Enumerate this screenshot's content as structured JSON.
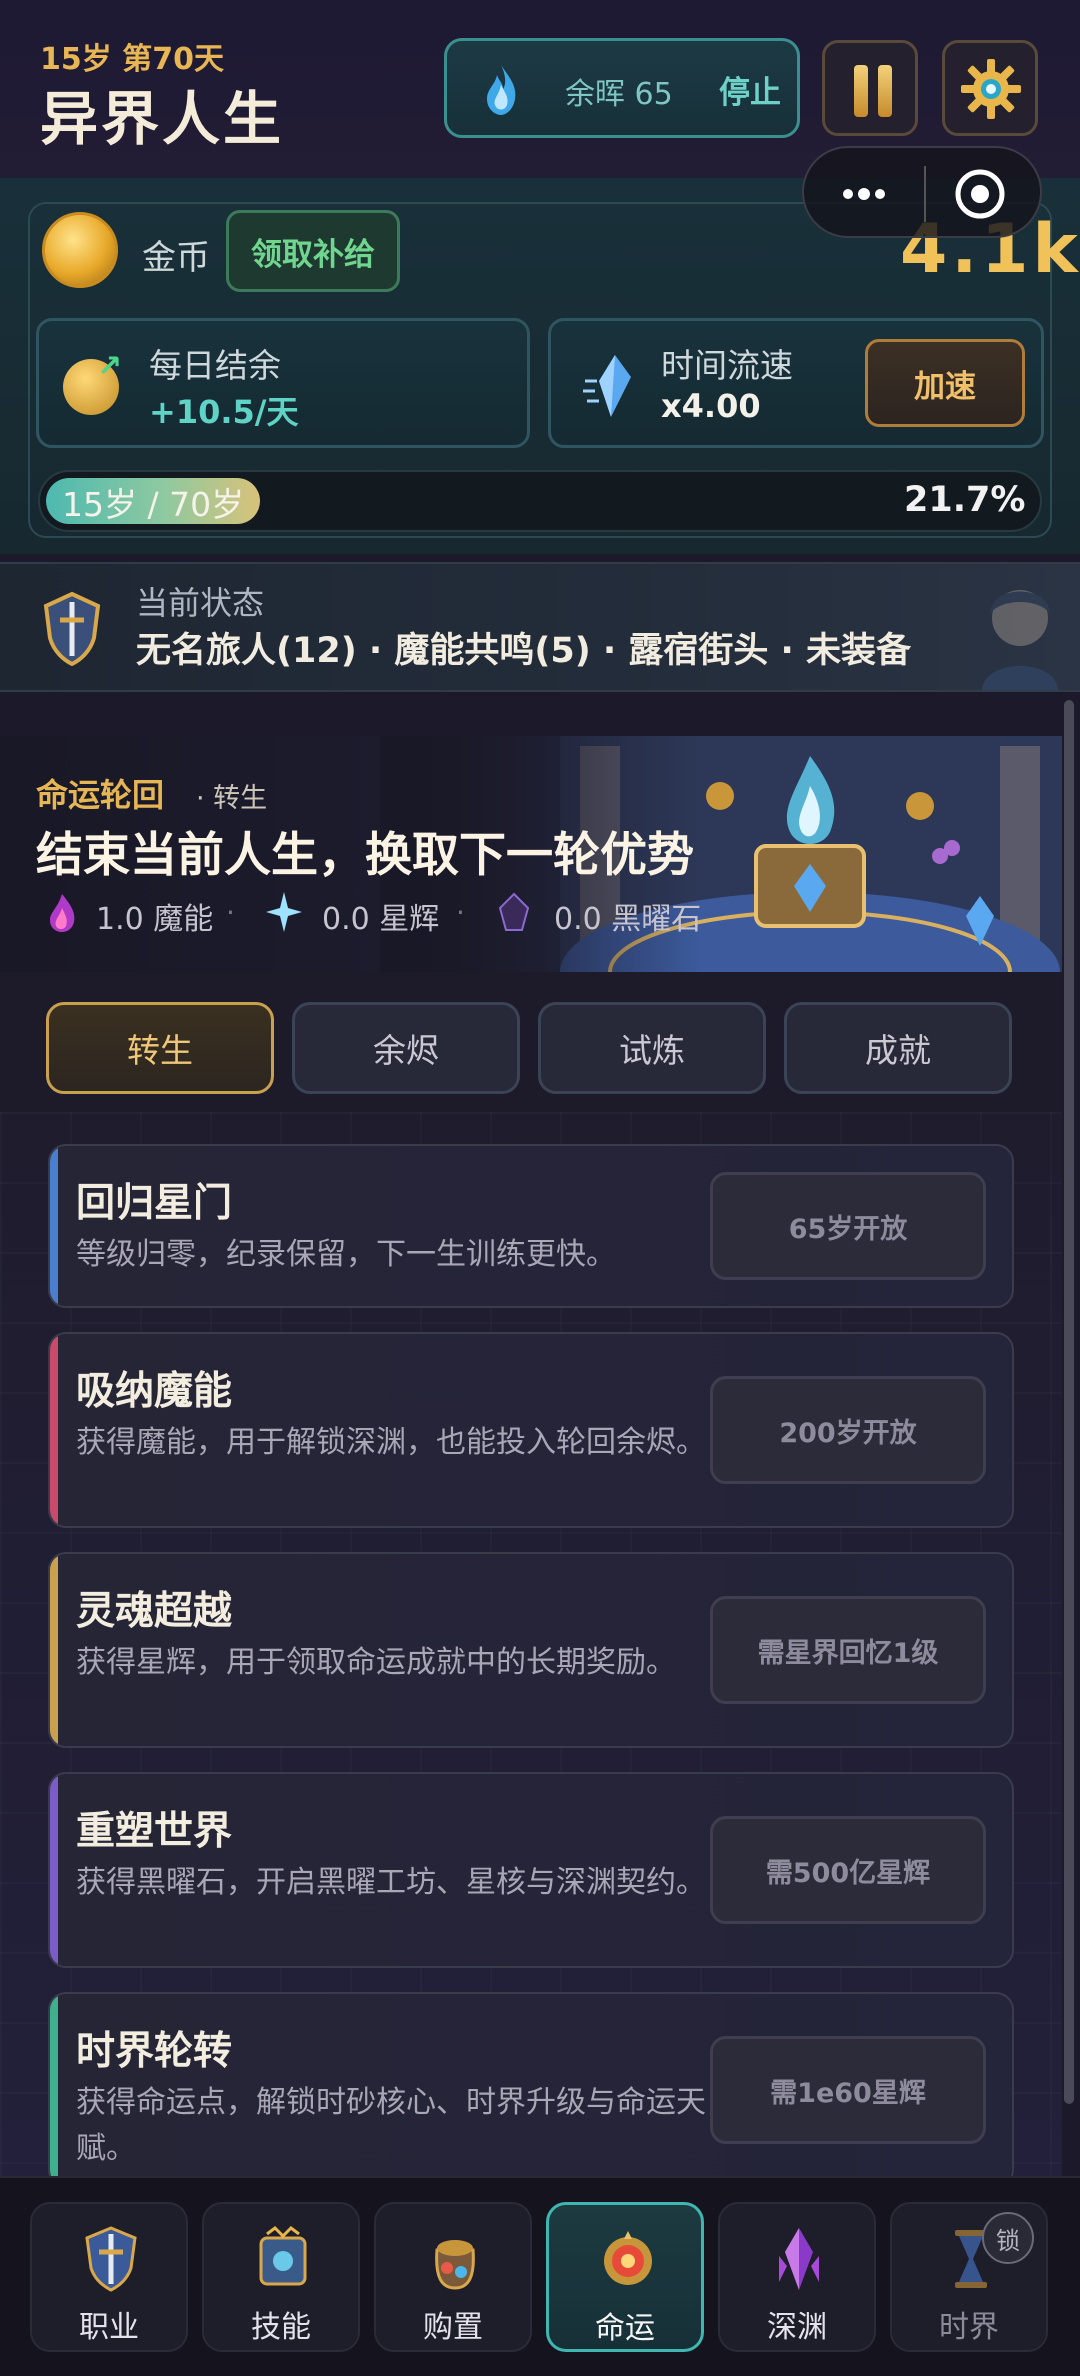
{
  "header": {
    "age_line": "15岁 第70天",
    "title": "异界人生",
    "ember_text": "余晖 65",
    "ember_stop": "停止"
  },
  "coins": {
    "label": "金币",
    "claim_label": "领取补给",
    "value": "4.1k"
  },
  "stats": {
    "daily_label": "每日结余",
    "daily_value": "+10.5/天",
    "speed_label": "时间流速",
    "speed_value": "x4.00",
    "accelerate_label": "加速"
  },
  "lifespan": {
    "label": "15岁 / 70岁",
    "percent_text": "21.7%",
    "progress": 0.217
  },
  "status": {
    "label": "当前状态",
    "text": "无名旅人(12) · 魔能共鸣(5) · 露宿街头 · 未装备"
  },
  "banner": {
    "kicker": "命运轮回",
    "kicker_sub": "· 转生",
    "title": "结束当前人生，换取下一轮优势",
    "resources": [
      {
        "value": "1.0 魔能",
        "icon": "magic-flame-icon"
      },
      {
        "value": "0.0 星辉",
        "icon": "star-crystal-icon"
      },
      {
        "value": "0.0 黑曜石",
        "icon": "obsidian-icon"
      }
    ]
  },
  "tabs": [
    {
      "label": "转生",
      "active": true
    },
    {
      "label": "余烬",
      "active": false
    },
    {
      "label": "试炼",
      "active": false
    },
    {
      "label": "成就",
      "active": false
    }
  ],
  "fate_cards": [
    {
      "title": "回归星门",
      "desc": "等级归零，纪录保留，下一生训练更快。",
      "button": "65岁开放",
      "accent": "#4a7fd0"
    },
    {
      "title": "吸纳魔能",
      "desc": "获得魔能，用于解锁深渊，也能投入轮回余烬。",
      "button": "200岁开放",
      "accent": "#c94a6a"
    },
    {
      "title": "灵魂超越",
      "desc": "获得星辉，用于领取命运成就中的长期奖励。",
      "button": "需星界回忆1级",
      "accent": "#c9a04e"
    },
    {
      "title": "重塑世界",
      "desc": "获得黑曜石，开启黑曜工坊、星核与深渊契约。",
      "button": "需500亿星辉",
      "accent": "#7b5cc8"
    },
    {
      "title": "时界轮转",
      "desc": "获得命运点，解锁时砂核心、时界升级与命运天赋。",
      "button": "需1e60星辉",
      "accent": "#3fb08e"
    }
  ],
  "nav": [
    {
      "label": "职业",
      "icon": "shield-sword-icon"
    },
    {
      "label": "技能",
      "icon": "spellbook-icon"
    },
    {
      "label": "购置",
      "icon": "bag-icon"
    },
    {
      "label": "命运",
      "icon": "fate-emblem-icon",
      "active": true
    },
    {
      "label": "深渊",
      "icon": "abyss-crystal-icon"
    },
    {
      "label": "时界",
      "icon": "hourglass-icon",
      "locked": true,
      "lock_label": "锁"
    }
  ],
  "colors": {
    "accent_gold": "#e9b654",
    "accent_teal": "#3fb6b0",
    "positive_green": "#6fd58f"
  }
}
